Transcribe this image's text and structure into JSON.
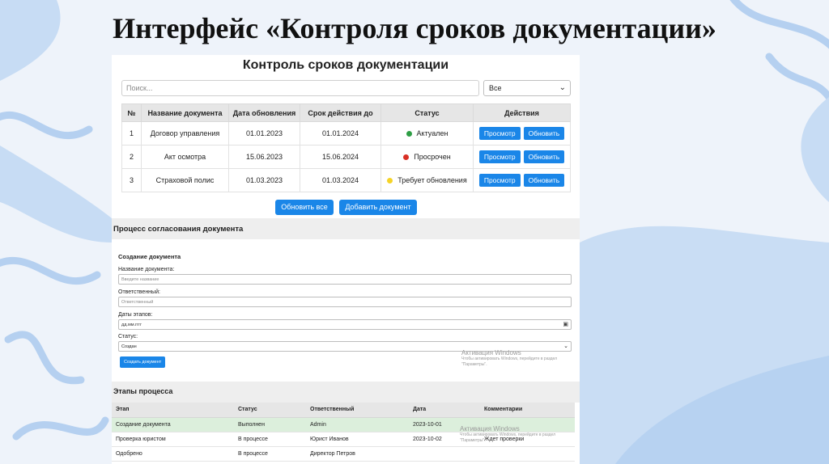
{
  "slide": {
    "title": "Интерфейс «Контроля сроков документации»"
  },
  "app": {
    "title": "Контроль сроков документации",
    "search_placeholder": "Поиск...",
    "filter_value": "Все",
    "table": {
      "headers": [
        "№",
        "Название документа",
        "Дата обновления",
        "Срок действия до",
        "Статус",
        "Действия"
      ],
      "rows": [
        {
          "num": "1",
          "name": "Договор управления",
          "updated": "01.01.2023",
          "valid_until": "01.01.2024",
          "status": "Актуален",
          "status_color": "#2e9e45",
          "view": "Просмотр",
          "update": "Обновить"
        },
        {
          "num": "2",
          "name": "Акт осмотра",
          "updated": "15.06.2023",
          "valid_until": "15.06.2024",
          "status": "Просрочен",
          "status_color": "#d93025",
          "view": "Просмотр",
          "update": "Обновить"
        },
        {
          "num": "3",
          "name": "Страховой полис",
          "updated": "01.03.2023",
          "valid_until": "01.03.2024",
          "status": "Требует обновления",
          "status_color": "#f5d327",
          "view": "Просмотр",
          "update": "Обновить"
        }
      ]
    },
    "update_all": "Обновить все",
    "add_document": "Добавить документ",
    "approval": {
      "title": "Процесс согласования документа",
      "form_title": "Создание документа",
      "name_label": "Название документа:",
      "name_placeholder": "Введите название",
      "responsible_label": "Ответственный:",
      "responsible_placeholder": "Ответственный",
      "dates_label": "Даты этапов:",
      "dates_placeholder": "дд.мм.гггг",
      "status_label": "Статус:",
      "status_value": "Создан",
      "create_button": "Создать документ"
    },
    "stages": {
      "title": "Этапы процесса",
      "headers": [
        "Этап",
        "Статус",
        "Ответственный",
        "Дата",
        "Комментарии"
      ],
      "rows": [
        {
          "stage": "Создание документа",
          "status": "Выполнен",
          "responsible": "Admin",
          "date": "2023-10-01",
          "comment": ""
        },
        {
          "stage": "Проверка юристом",
          "status": "В процессе",
          "responsible": "Юрист Иванов",
          "date": "2023-10-02",
          "comment": "Ждет проверки"
        },
        {
          "stage": "Одобрено",
          "status": "В процессе",
          "responsible": "Директор Петров",
          "date": "",
          "comment": ""
        }
      ]
    },
    "watermark": {
      "title": "Активация Windows",
      "text": "Чтобы активировать Windows, перейдите в раздел \"Параметры\"."
    }
  },
  "colors": {
    "accent": "#1a86e8",
    "wave": "#a9c8ec"
  }
}
